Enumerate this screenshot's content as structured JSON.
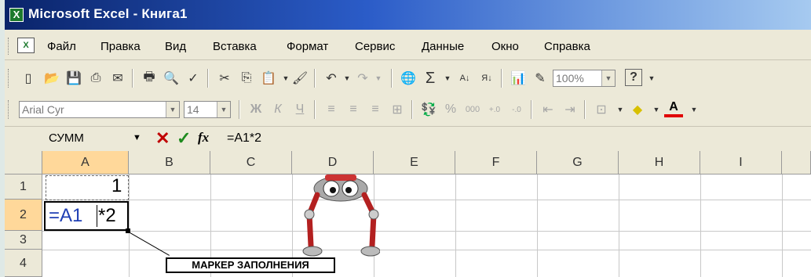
{
  "window": {
    "title": "Microsoft Excel - Книга1"
  },
  "menu": [
    "Файл",
    "Правка",
    "Вид",
    "Вставка",
    "Формат",
    "Сервис",
    "Данные",
    "Окно",
    "Справка"
  ],
  "toolbar": {
    "zoom": "100%",
    "help": "?"
  },
  "format_toolbar": {
    "font": "Arial Cyr",
    "size": "14",
    "bold": "Ж",
    "italic": "К",
    "underline": "Ч",
    "percent": "%",
    "thousands": "000"
  },
  "formula_bar": {
    "name_box": "СУММ",
    "fx_label": "fx",
    "formula": "=A1*2"
  },
  "columns": [
    "A",
    "B",
    "C",
    "D",
    "E",
    "F",
    "G",
    "H",
    "I"
  ],
  "rows": [
    "1",
    "2",
    "3",
    "4"
  ],
  "cells": {
    "A1": "1",
    "A2_ref": "=A1",
    "A2_rest": "*2"
  },
  "callout": "МАРКЕР ЗАПОЛНЕНИЯ",
  "colors": {
    "ref": "#1f3fb4",
    "cancel": "#c00000",
    "enter": "#1e8a1e"
  }
}
